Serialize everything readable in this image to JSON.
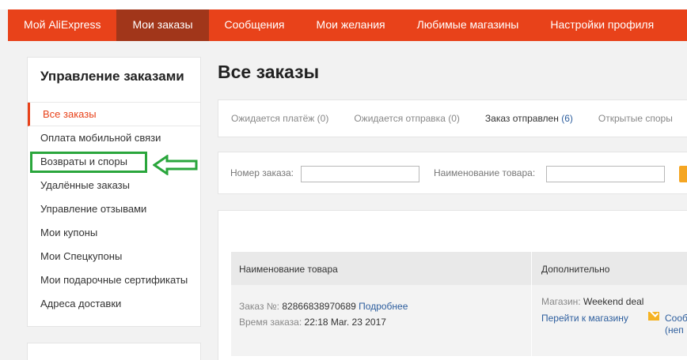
{
  "topnav": {
    "items": [
      {
        "label": "Мой AliExpress",
        "active": false
      },
      {
        "label": "Мои заказы",
        "active": true
      },
      {
        "label": "Сообщения",
        "active": false
      },
      {
        "label": "Мои желания",
        "active": false
      },
      {
        "label": "Любимые магазины",
        "active": false
      },
      {
        "label": "Настройки профиля",
        "active": false
      }
    ]
  },
  "sidebar": {
    "title": "Управление заказами",
    "items": [
      {
        "label": "Все заказы"
      },
      {
        "label": "Оплата мобильной связи"
      },
      {
        "label": "Возвраты и споры"
      },
      {
        "label": "Удалённые заказы"
      },
      {
        "label": "Управление отзывами"
      },
      {
        "label": "Мои купоны"
      },
      {
        "label": "Мои Спецкупоны"
      },
      {
        "label": "Мои подарочные сертификаты"
      },
      {
        "label": "Адреса доставки"
      }
    ]
  },
  "main": {
    "title": "Все заказы",
    "tabs": [
      {
        "label": "Ожидается платёж",
        "count": "(0)"
      },
      {
        "label": "Ожидается отправка",
        "count": "(0)"
      },
      {
        "label": "Заказ отправлен",
        "count": "(6)"
      },
      {
        "label": "Открытые споры",
        "count": ""
      }
    ],
    "search": {
      "order_number_label": "Номер заказа:",
      "product_name_label": "Наименование товара:"
    },
    "table": {
      "col_product": "Наименование товара",
      "col_additional": "Дополнительно"
    },
    "order": {
      "number_label": "Заказ №:",
      "number": "82866838970689",
      "details_link": "Подробнее",
      "time_label": "Время заказа:",
      "time": "22:18 Mar. 23 2017",
      "store_label": "Магазин:",
      "store_name": "Weekend deal",
      "store_link": "Перейти к магазину",
      "contact_link": "Сооб",
      "contact_link_2": "(неп"
    }
  },
  "colors": {
    "brand": "#e8421a",
    "nav_active": "#a1361a",
    "highlight": "#2aa63c",
    "link": "#2d5e9e"
  }
}
